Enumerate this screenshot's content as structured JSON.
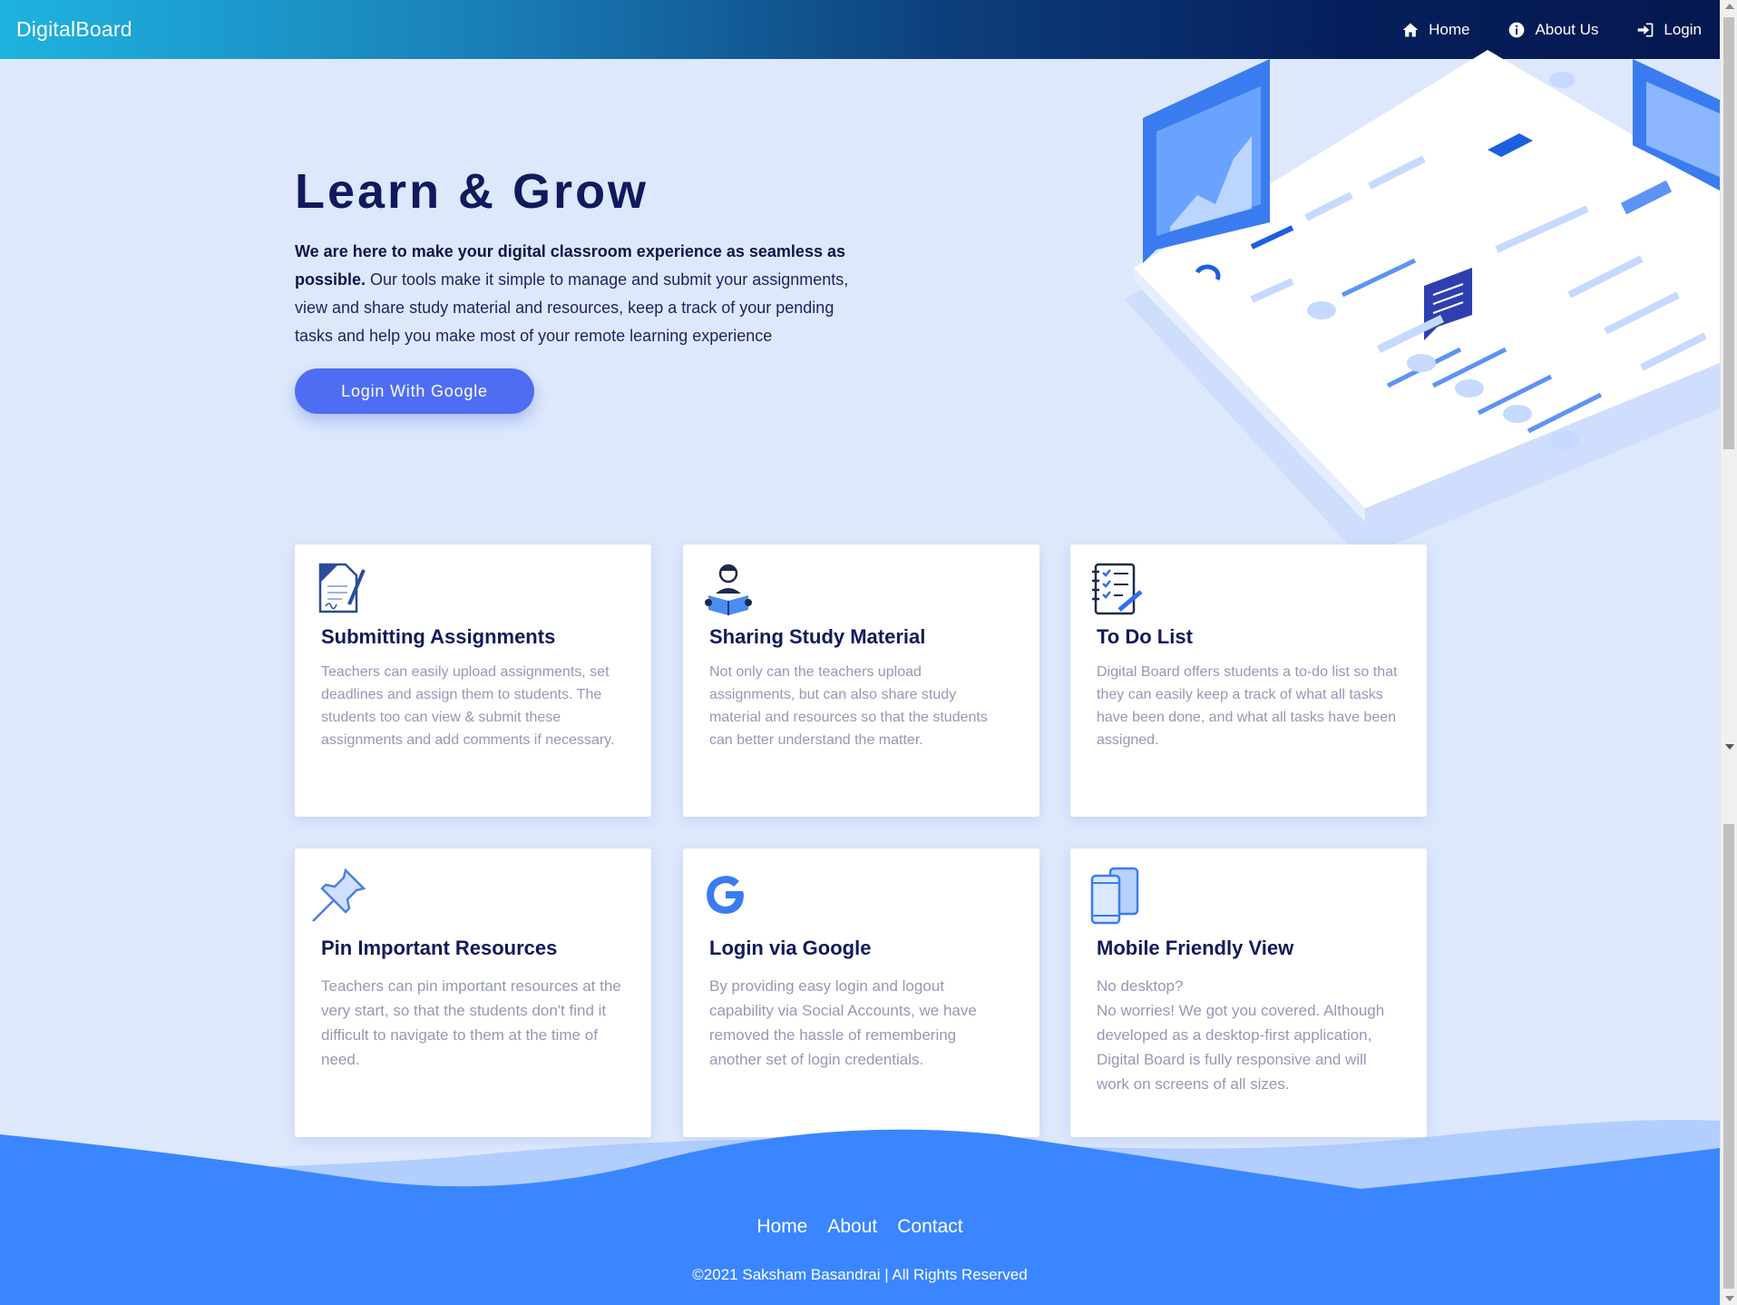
{
  "navbar": {
    "brand": "DigitalBoard",
    "links": [
      {
        "label": "Home",
        "icon": "home-icon"
      },
      {
        "label": "About Us",
        "icon": "info-icon"
      },
      {
        "label": "Login",
        "icon": "sign-in-icon"
      }
    ]
  },
  "hero": {
    "title": "Learn & Grow",
    "lead_bold": "We are here to make your digital classroom experience as seamless as possible.",
    "lead_rest": " Our tools make it simple to manage and submit your assignments, view and share study material and resources, keep a track of your pending tasks and help you make most of your remote learning experience",
    "button_label": "Login With Google"
  },
  "features": [
    {
      "title": "Submitting Assignments",
      "icon": "assignment-document-icon",
      "description": "Teachers can easily upload assignments, set deadlines and assign them to students. The students too can view & submit these assignments and add comments if necessary."
    },
    {
      "title": "Sharing Study Material",
      "icon": "reading-student-icon",
      "description": "Not only can the teachers upload assignments, but can also share study material and resources so that the students can better understand the matter."
    },
    {
      "title": "To Do List",
      "icon": "checklist-icon",
      "description": "Digital Board offers students a to-do list so that they can easily keep a track of what all tasks have been done, and what all tasks have been assigned."
    },
    {
      "title": "Pin Important Resources",
      "icon": "pushpin-icon",
      "description": "Teachers can pin important resources at the very start, so that the students don't find it difficult to navigate to them at the time of need."
    },
    {
      "title": "Login via Google",
      "icon": "google-icon",
      "description": "By providing easy login and logout capability via Social Accounts, we have removed the hassle of remembering another set of login credentials."
    },
    {
      "title": "Mobile Friendly View",
      "icon": "mobile-devices-icon",
      "description_line1": "No desktop?",
      "description": "No worries! We got you covered. Although developed as a desktop-first application, Digital Board is fully responsive and will work on screens of all sizes."
    }
  ],
  "footer": {
    "links": [
      "Home",
      "About",
      "Contact"
    ],
    "copyright": "©2021 Saksham Basandrai | All Rights Reserved"
  },
  "colors": {
    "background": "#dde8fd",
    "primary_button": "#4e6df2",
    "footer_blue": "#3a86ff",
    "heading": "#121a5a"
  }
}
